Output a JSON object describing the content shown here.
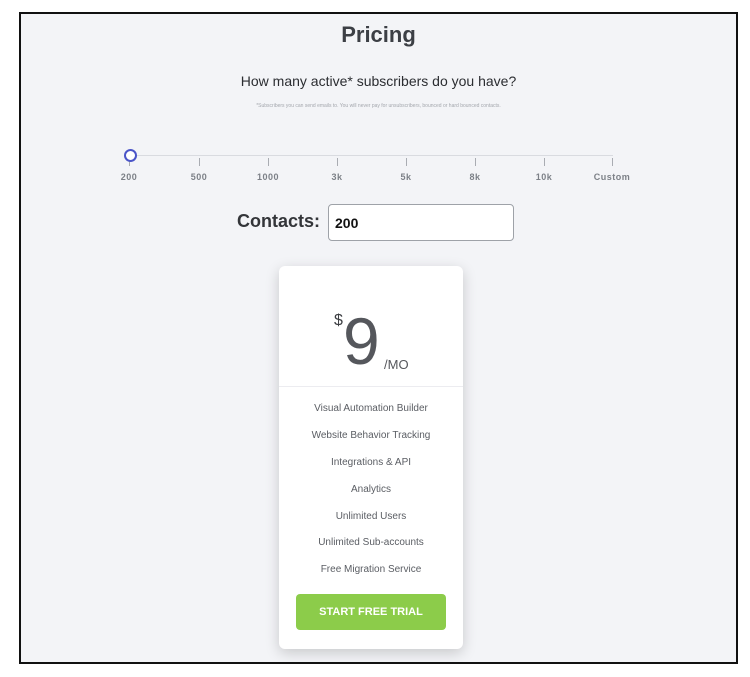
{
  "header": {
    "title": "Pricing",
    "question": "How many active* subscribers do you have?",
    "footnote": "*Subscribers you can send emails to. You will never pay for unsubscribers, bounced or hard bounced contacts."
  },
  "slider": {
    "selected_index": 0,
    "ticks": [
      "200",
      "500",
      "1000",
      "3k",
      "5k",
      "8k",
      "10k",
      "Custom"
    ]
  },
  "contacts": {
    "label": "Contacts:",
    "value": "200"
  },
  "plan": {
    "currency": "$",
    "price": "9",
    "period": "/MO",
    "features": [
      "Visual Automation Builder",
      "Website Behavior Tracking",
      "Integrations & API",
      "Analytics",
      "Unlimited Users",
      "Unlimited Sub-accounts",
      "Free Migration Service"
    ],
    "cta_label": "START FREE TRIAL"
  },
  "colors": {
    "accent": "#8ccc4a",
    "slider_handle": "#4b55c8",
    "background": "#f3f4f7"
  }
}
